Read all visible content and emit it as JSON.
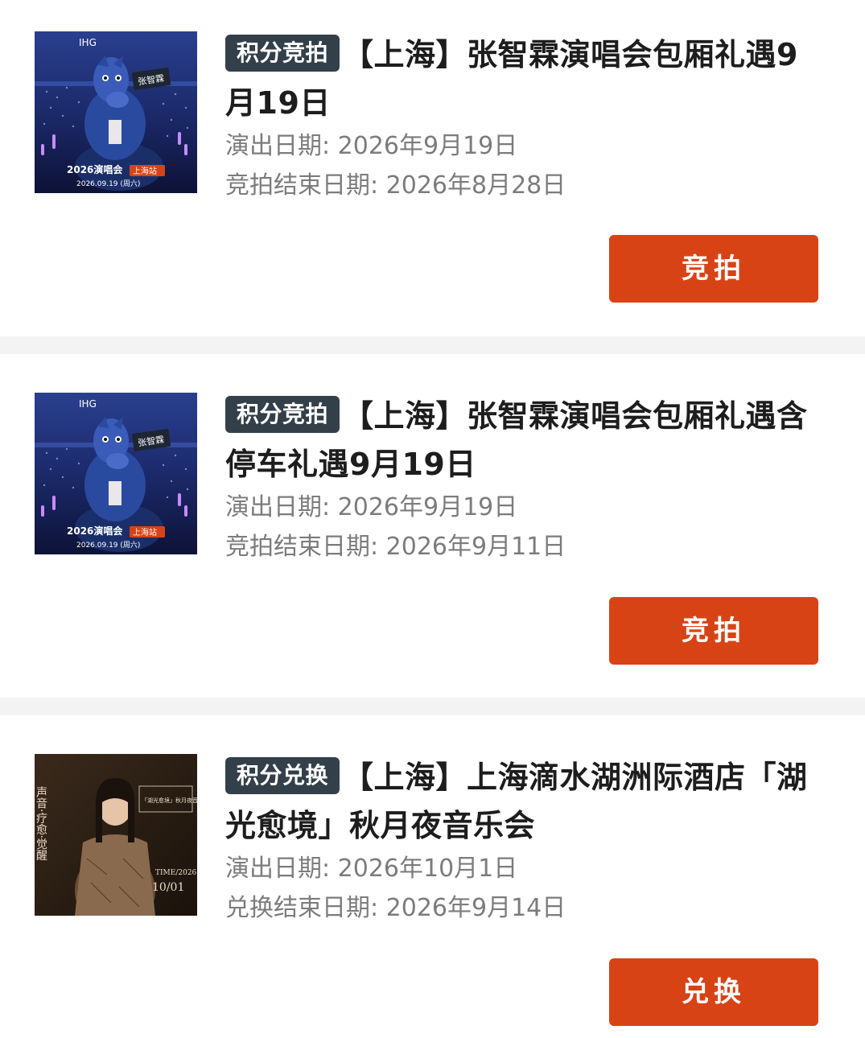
{
  "items": [
    {
      "tag": "积分竞拍",
      "title": "【上海】张智霖演唱会包厢礼遇9月19日",
      "show_date": "演出日期: 2026年9月19日",
      "end_date": "竞拍结束日期: 2026年8月28日",
      "button": "竞拍",
      "poster": {
        "brand": "IHG",
        "sign": "张智霖",
        "event": "2026演唱会",
        "station": "上海站",
        "date": "2026.09.19 (周六)"
      }
    },
    {
      "tag": "积分竞拍",
      "title": "【上海】张智霖演唱会包厢礼遇含停车礼遇9月19日",
      "show_date": "演出日期: 2026年9月19日",
      "end_date": "竞拍结束日期: 2026年9月11日",
      "button": "竞拍",
      "poster": {
        "brand": "IHG",
        "sign": "张智霖",
        "event": "2026演唱会",
        "station": "上海站",
        "date": "2026.09.19 (周六)"
      }
    },
    {
      "tag": "积分兑换",
      "title": "【上海】上海滴水湖洲际酒店「湖光愈境」秋月夜音乐会",
      "show_date": "演出日期: 2026年10月1日",
      "end_date": "兑换结束日期: 2026年9月14日",
      "button": "兑换",
      "poster": {
        "vertical": "声音·疗愈·觉醒",
        "box": "「湖光愈境」秋月夜音乐会",
        "time": "TIME/2026",
        "date": "10/01"
      }
    }
  ],
  "colors": {
    "button": "#d84315",
    "tag": "#33404a",
    "divider": "#f3f3f3",
    "meta_text": "#7c7c7c",
    "title_text": "#1d1d1d"
  }
}
